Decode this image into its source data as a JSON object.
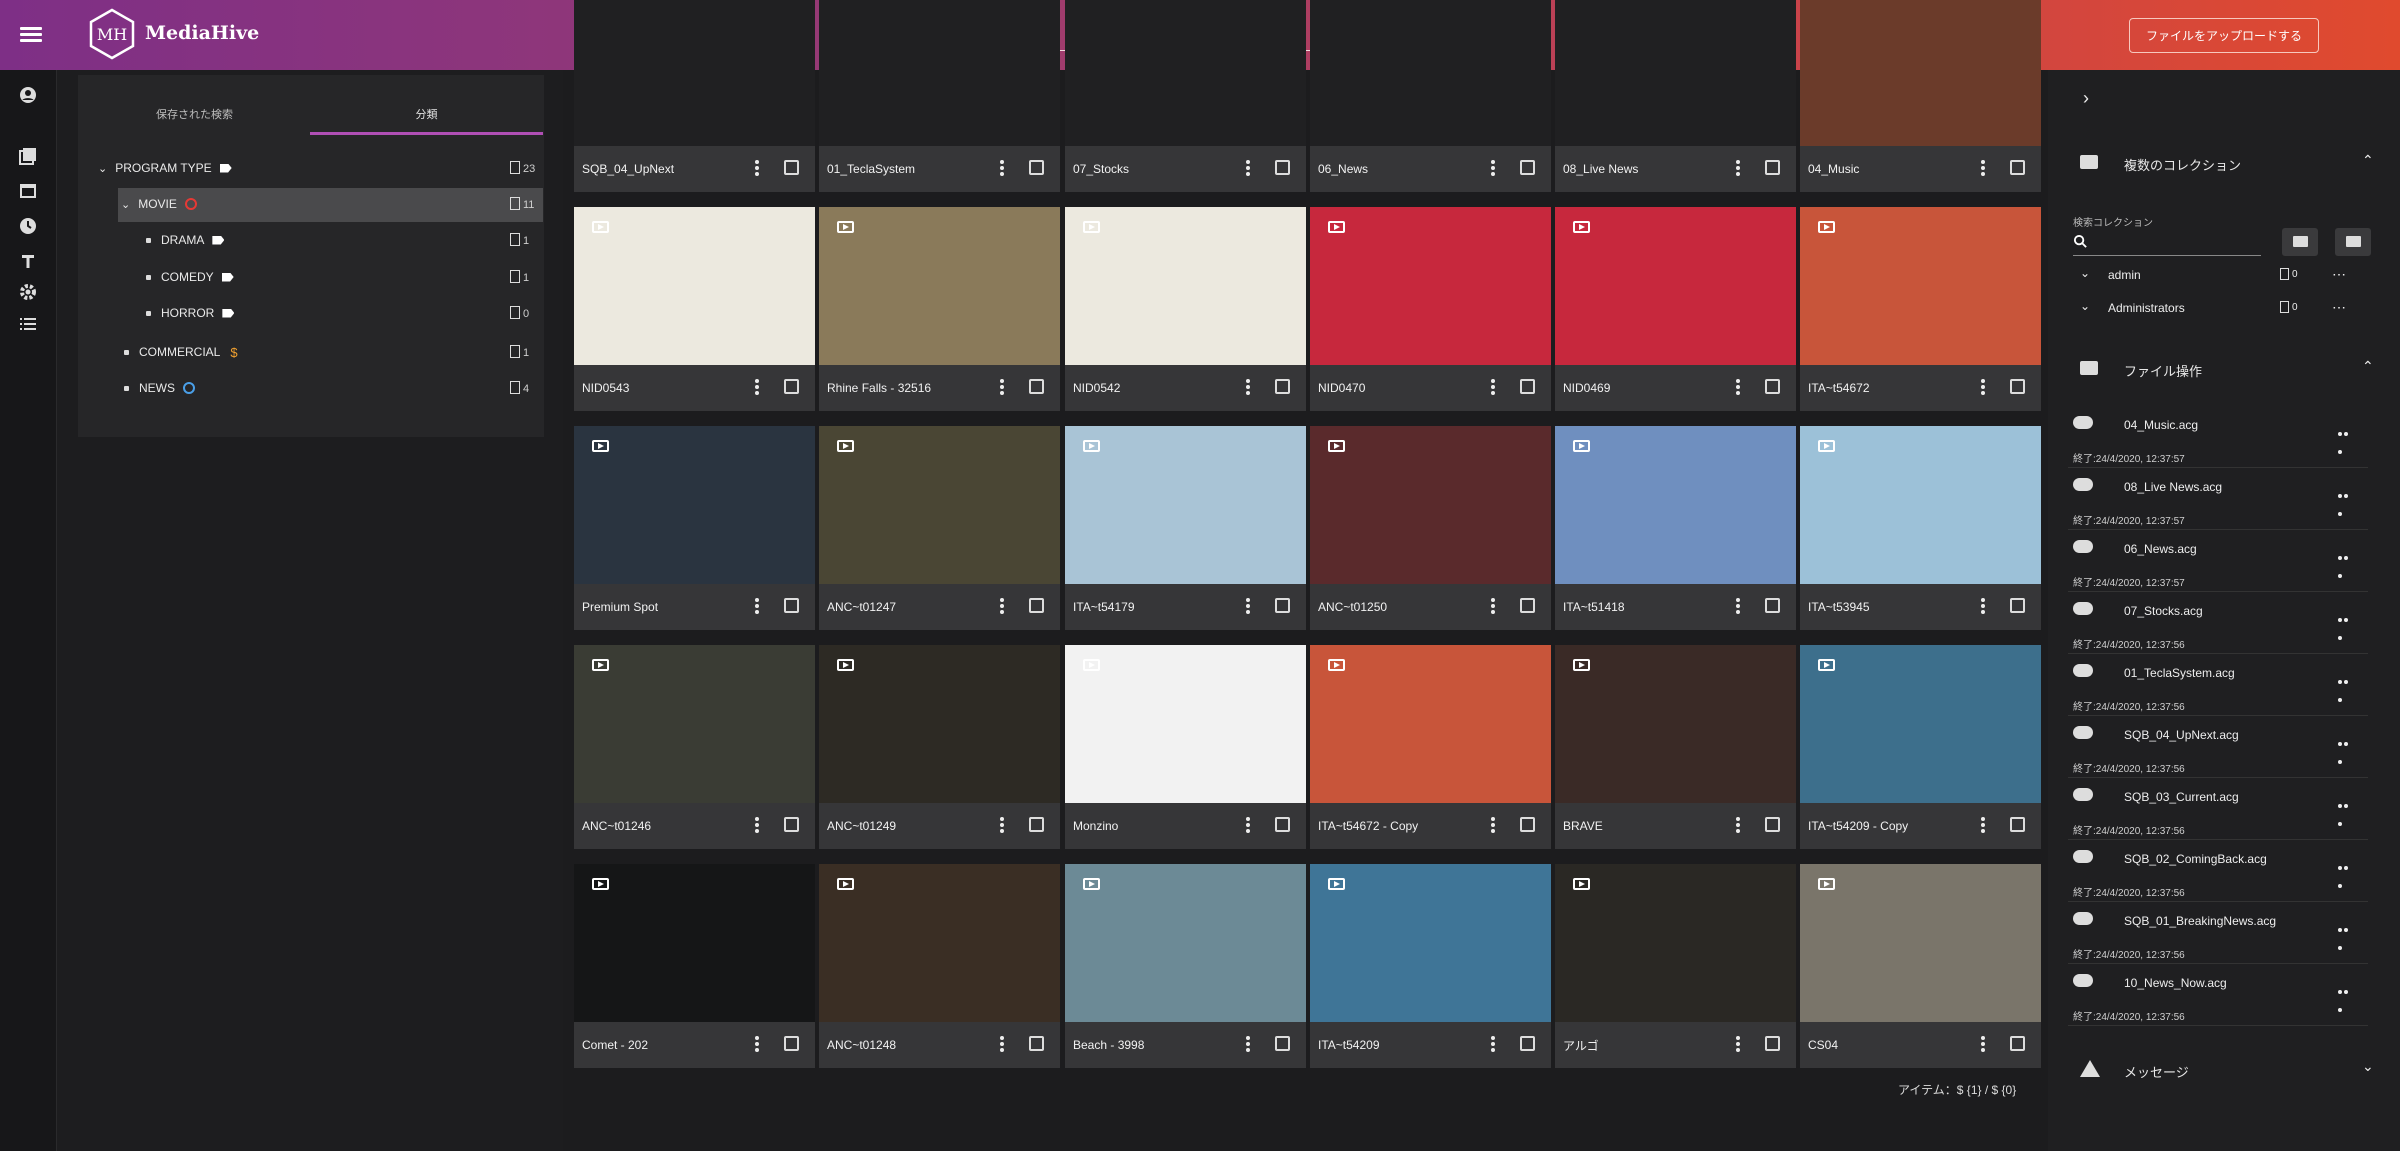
{
  "app": {
    "name": "MediaHive",
    "logo_text": "MH",
    "upload_label": "ファイルをアップロードする"
  },
  "tree": {
    "tabs": [
      "保存された検索",
      "分類"
    ],
    "rows": [
      {
        "label": "PROGRAM TYPE",
        "count": "23"
      },
      {
        "label": "MOVIE",
        "count": "11"
      },
      {
        "label": "DRAMA",
        "count": "1"
      },
      {
        "label": "COMEDY",
        "count": "1"
      },
      {
        "label": "HORROR",
        "count": "0"
      },
      {
        "label": "COMMERCIAL",
        "count": "1"
      },
      {
        "label": "NEWS",
        "count": "4"
      }
    ]
  },
  "grid": {
    "items": [
      {
        "title": "SQB_04_UpNext",
        "color": "#202022"
      },
      {
        "title": "01_TeclaSystem",
        "color": "#202022"
      },
      {
        "title": "07_Stocks",
        "color": "#202022"
      },
      {
        "title": "06_News",
        "color": "#202022"
      },
      {
        "title": "08_Live News",
        "color": "#202022"
      },
      {
        "title": "04_Music",
        "color": "#6b3b2a"
      },
      {
        "title": "NID0543",
        "color": "#ece9df"
      },
      {
        "title": "Rhine Falls - 32516",
        "color": "#8a7a5a"
      },
      {
        "title": "NID0542",
        "color": "#ece9df"
      },
      {
        "title": "NID0470",
        "color": "#c7283d"
      },
      {
        "title": "NID0469",
        "color": "#c7283d"
      },
      {
        "title": "ITA~t54672",
        "color": "#c8553a"
      },
      {
        "title": "Premium Spot",
        "color": "#2a3440"
      },
      {
        "title": "ANC~t01247",
        "color": "#4a4634"
      },
      {
        "title": "ITA~t54179",
        "color": "#a9c4d6"
      },
      {
        "title": "ANC~t01250",
        "color": "#5a2a2c"
      },
      {
        "title": "ITA~t51418",
        "color": "#6f8fbf"
      },
      {
        "title": "ITA~t53945",
        "color": "#9cc1d8"
      },
      {
        "title": "ANC~t01246",
        "color": "#3a3c34"
      },
      {
        "title": "ANC~t01249",
        "color": "#2d2a24"
      },
      {
        "title": "Monzino",
        "color": "#f2f2f2"
      },
      {
        "title": "ITA~t54672 - Copy",
        "color": "#c8553a"
      },
      {
        "title": "BRAVE",
        "color": "#3a2a26"
      },
      {
        "title": "ITA~t54209 - Copy",
        "color": "#3d6f8c"
      },
      {
        "title": "Comet - 202",
        "color": "#151617"
      },
      {
        "title": "ANC~t01248",
        "color": "#3a2e24"
      },
      {
        "title": "Beach - 3998",
        "color": "#6c8a96"
      },
      {
        "title": "ITA~t54209",
        "color": "#3f7597"
      },
      {
        "title": "アルゴ",
        "color": "#2a2824"
      },
      {
        "title": "CS04",
        "color": "#7a756a"
      }
    ],
    "footer": "アイテム：$ {1} / $ {0}"
  },
  "right": {
    "collections_title": "複数のコレクション",
    "search_label": "検索コレクション",
    "collections": [
      {
        "name": "admin",
        "count": "0"
      },
      {
        "name": "Administrators",
        "count": "0"
      }
    ],
    "fileops_title": "ファイル操作",
    "fileops": [
      {
        "name": "04_Music.acg",
        "time": "終了:24/4/2020, 12:37:57"
      },
      {
        "name": "08_Live News.acg",
        "time": "終了:24/4/2020, 12:37:57"
      },
      {
        "name": "06_News.acg",
        "time": "終了:24/4/2020, 12:37:57"
      },
      {
        "name": "07_Stocks.acg",
        "time": "終了:24/4/2020, 12:37:56"
      },
      {
        "name": "01_TeclaSystem.acg",
        "time": "終了:24/4/2020, 12:37:56"
      },
      {
        "name": "SQB_04_UpNext.acg",
        "time": "終了:24/4/2020, 12:37:56"
      },
      {
        "name": "SQB_03_Current.acg",
        "time": "終了:24/4/2020, 12:37:56"
      },
      {
        "name": "SQB_02_ComingBack.acg",
        "time": "終了:24/4/2020, 12:37:56"
      },
      {
        "name": "SQB_01_BreakingNews.acg",
        "time": "終了:24/4/2020, 12:37:56"
      },
      {
        "name": "10_News_Now.acg",
        "time": "終了:24/4/2020, 12:37:56"
      }
    ],
    "messages_title": "メッセージ"
  }
}
